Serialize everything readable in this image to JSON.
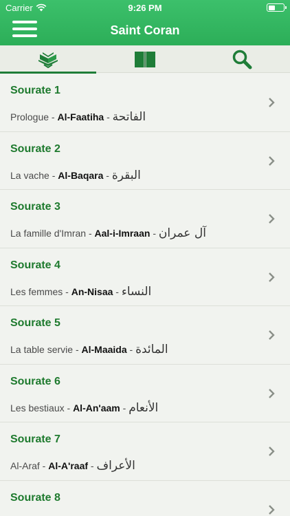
{
  "status": {
    "carrier": "Carrier",
    "time": "9:26 PM"
  },
  "header": {
    "title": "Saint Coran"
  },
  "tabs": [
    {
      "icon": "quran-book-icon"
    },
    {
      "icon": "open-book-icon"
    },
    {
      "icon": "search-icon"
    }
  ],
  "separator": " - ",
  "colors": {
    "accent": "#1e7a2e",
    "header": "#2cae58"
  },
  "sourates": [
    {
      "title": "Sourate 1",
      "french": "Prologue",
      "translit": "Al-Faatiha",
      "arabic": "الفاتحة"
    },
    {
      "title": "Sourate 2",
      "french": "La vache",
      "translit": "Al-Baqara",
      "arabic": "البقرة"
    },
    {
      "title": "Sourate 3",
      "french": "La famille d'Imran",
      "translit": "Aal-i-Imraan",
      "arabic": "آل عمران"
    },
    {
      "title": "Sourate 4",
      "french": "Les femmes",
      "translit": "An-Nisaa",
      "arabic": "النساء"
    },
    {
      "title": "Sourate 5",
      "french": "La table servie",
      "translit": "Al-Maaida",
      "arabic": "المائدة"
    },
    {
      "title": "Sourate 6",
      "french": "Les bestiaux",
      "translit": "Al-An'aam",
      "arabic": "الأنعام"
    },
    {
      "title": "Sourate 7",
      "french": "Al-Araf",
      "translit": "Al-A'raaf",
      "arabic": "الأعراف"
    },
    {
      "title": "Sourate 8",
      "french": "",
      "translit": "",
      "arabic": ""
    }
  ]
}
